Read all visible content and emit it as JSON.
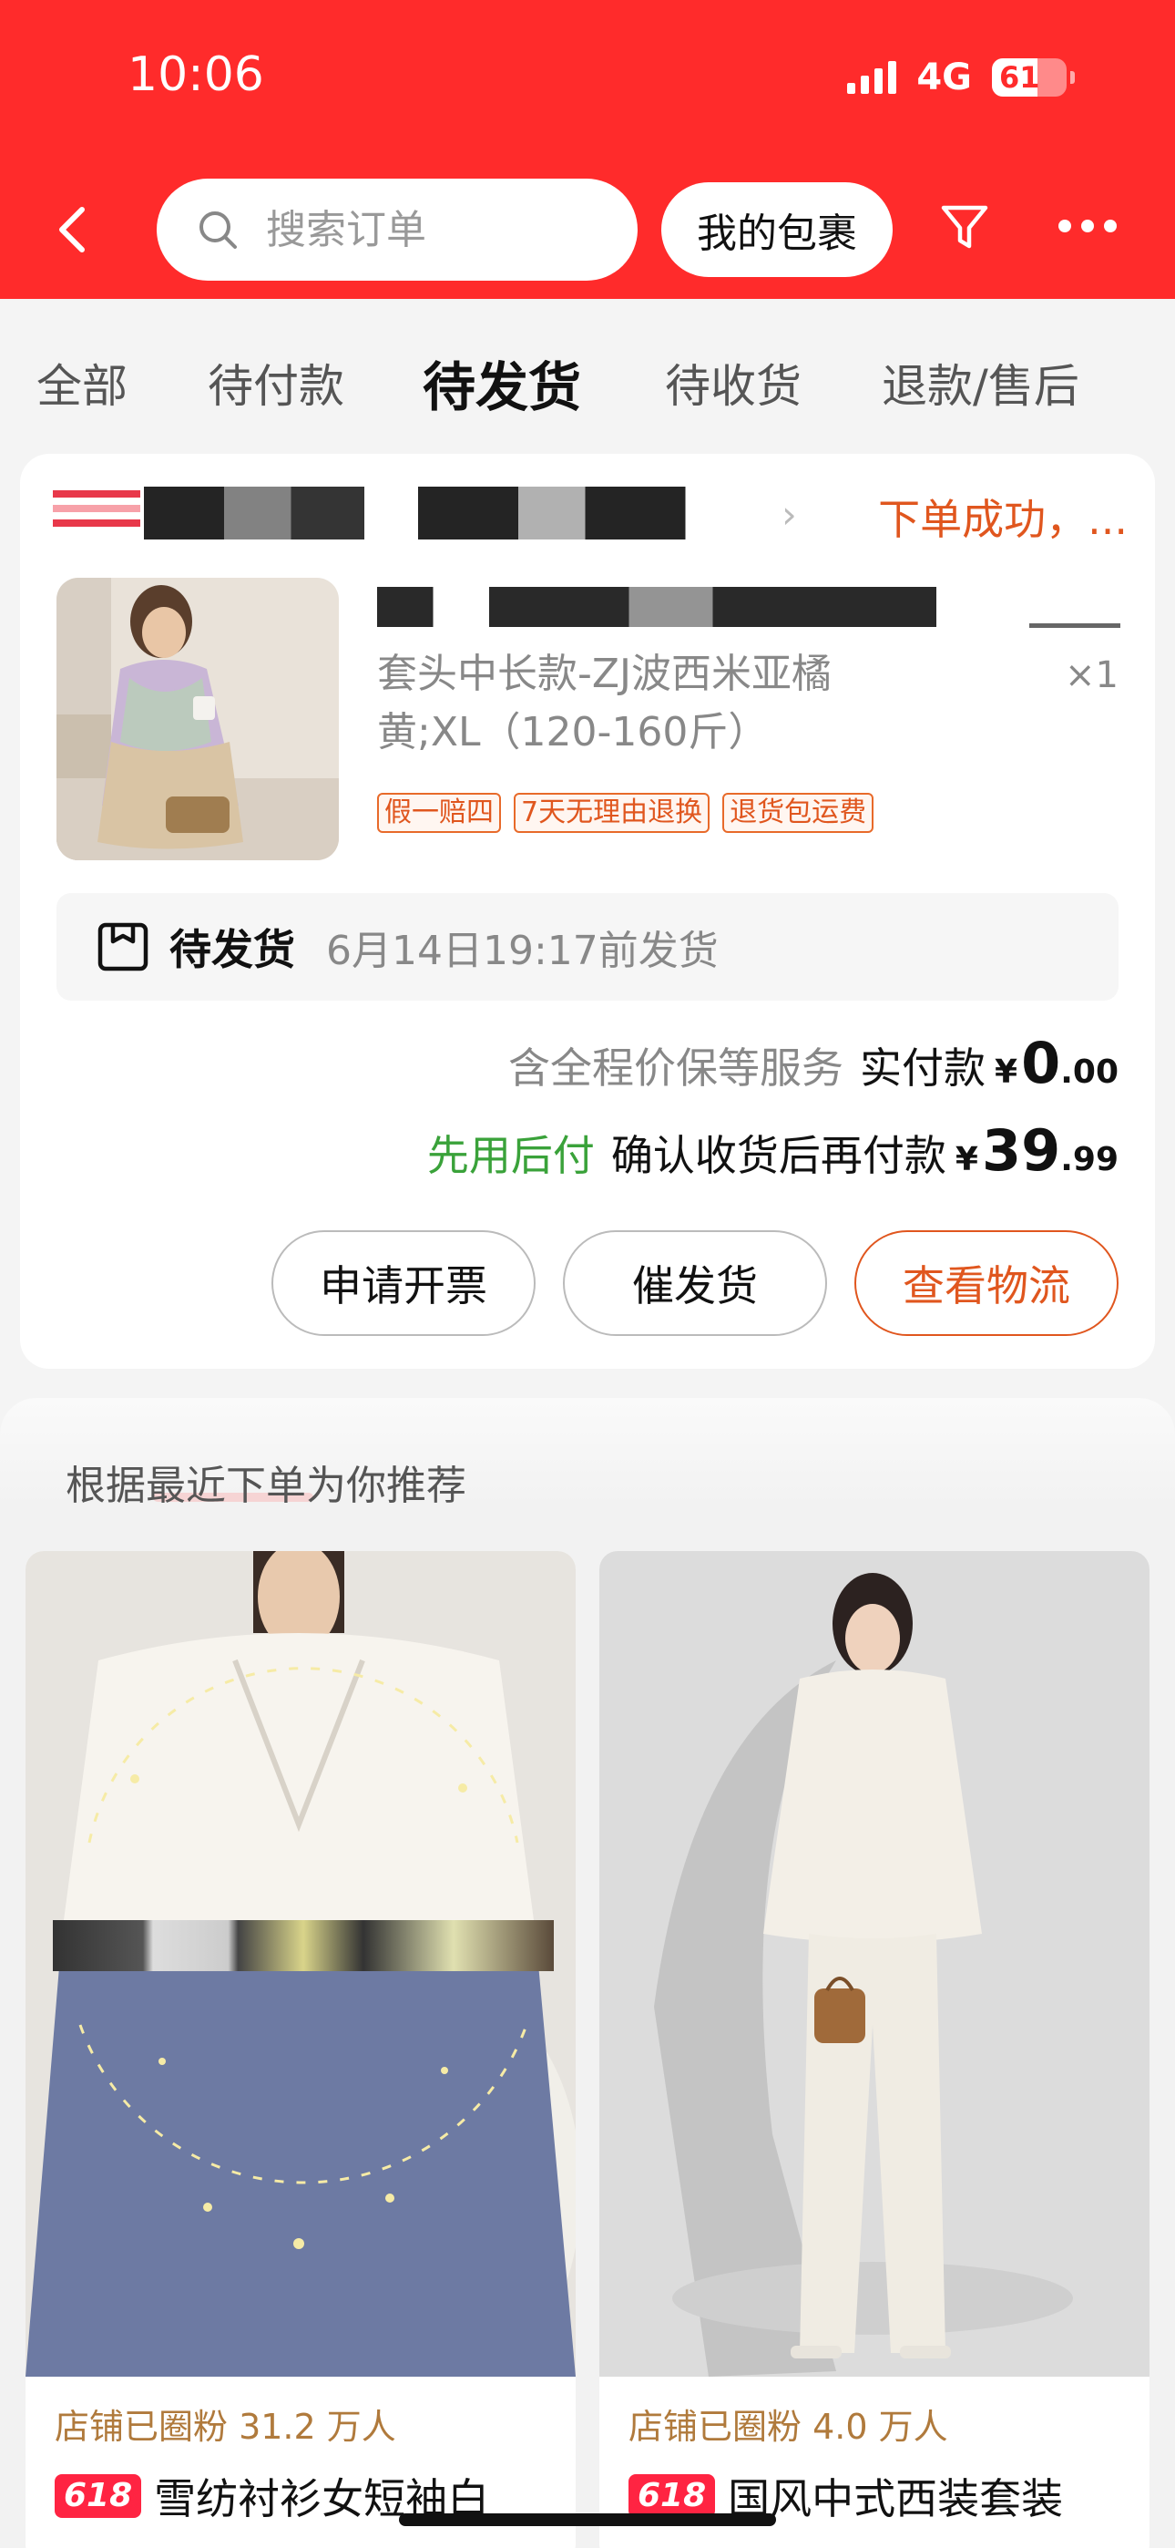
{
  "status_bar": {
    "time": "10:06",
    "network": "4G",
    "battery": "61"
  },
  "header": {
    "search_placeholder": "搜索订单",
    "parcel_label": "我的包裹"
  },
  "tabs": [
    {
      "label": "全部"
    },
    {
      "label": "待付款"
    },
    {
      "label": "待发货",
      "active": true
    },
    {
      "label": "待收货"
    },
    {
      "label": "退款/售后"
    }
  ],
  "order": {
    "status_text": "下单成功，...",
    "sku": "套头中长款-ZJ波西米亚橘黄;XL（120-160斤）",
    "quantity": "×1",
    "badges": [
      "假一赔四",
      "7天无理由退换",
      "退货包运费"
    ],
    "ship_status": "待发货",
    "ship_time": "6月14日19:17前发货",
    "service_text": "含全程价保等服务",
    "paid_label": "实付款",
    "yen": "¥",
    "paid_int": "0",
    "paid_dec": ".00",
    "later_pay": "先用后付",
    "confirm_text": "确认收货后再付款",
    "later_int": "39",
    "later_dec": ".99",
    "buttons": {
      "invoice": "申请开票",
      "urge": "催发货",
      "track": "查看物流"
    }
  },
  "recommend": {
    "title": "根据最近下单为你推荐",
    "items": [
      {
        "fans": "店铺已圈粉 31.2 万人",
        "tag": "618",
        "name": "雪纺衬衫女短袖白"
      },
      {
        "fans": "店铺已圈粉 4.0 万人",
        "tag": "618",
        "name": "国风中式西装套装"
      }
    ]
  },
  "colors": {
    "header_red": "#ff2b2b",
    "accent_orange": "#e0561e",
    "later_pay_green": "#3aa23a"
  }
}
